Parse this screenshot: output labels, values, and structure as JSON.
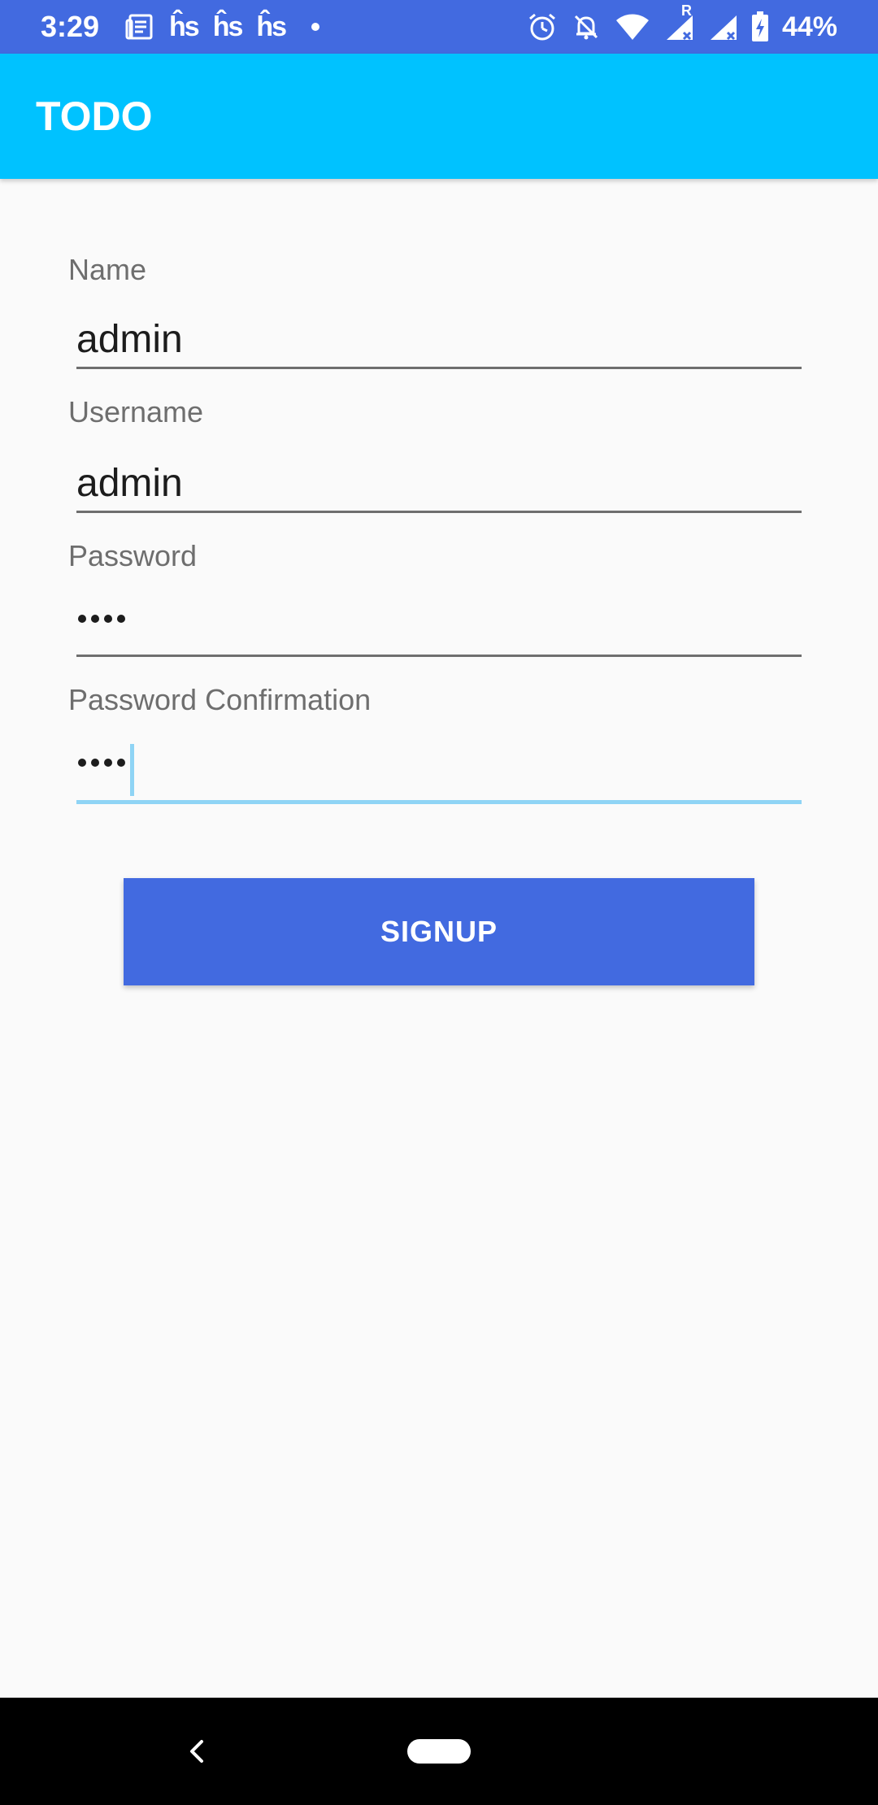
{
  "status_bar": {
    "time": "3:29",
    "left_icons": [
      "news-icon",
      "hs-icon",
      "hs-icon",
      "hs-icon",
      "dot-icon"
    ],
    "hs_glyph": "ĥs",
    "right_icons": [
      "alarm-icon",
      "bell-off-icon",
      "wifi-icon",
      "signal-r-icon",
      "signal-icon",
      "battery-charging-icon"
    ],
    "signal_roaming_label": "R",
    "battery_percent": "44%"
  },
  "app_bar": {
    "title": "TODO"
  },
  "form": {
    "name": {
      "label": "Name",
      "value": "admin"
    },
    "username": {
      "label": "Username",
      "value": "admin"
    },
    "password": {
      "label": "Password",
      "masked_length": 4
    },
    "password_confirmation": {
      "label": "Password Confirmation",
      "masked_length": 4,
      "focused": true
    }
  },
  "signup_button": {
    "label": "SIGNUP"
  },
  "nav_bar": {
    "icons": [
      "back-icon",
      "home-pill-icon"
    ]
  },
  "colors": {
    "status_bar": "#426AE0",
    "app_bar": "#00C2FF",
    "button": "#426AE0",
    "background": "#FAFAFA",
    "focus_underline": "#8FD4F5",
    "label": "#6E6E6E",
    "text": "#1C1C1C",
    "nav_bar": "#000000"
  }
}
